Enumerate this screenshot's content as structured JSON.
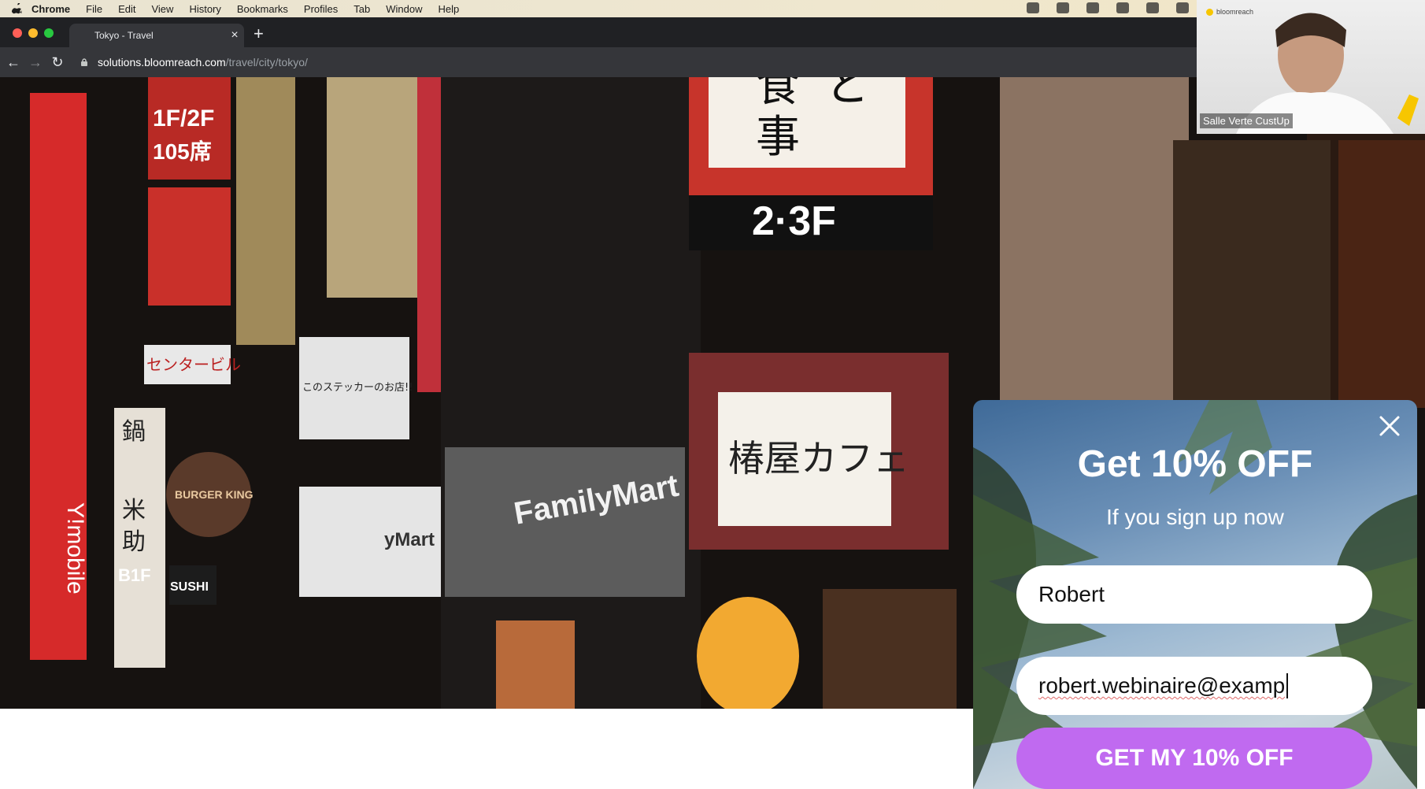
{
  "menubar": {
    "items": [
      "Chrome",
      "File",
      "Edit",
      "View",
      "History",
      "Bookmarks",
      "Profiles",
      "Tab",
      "Window",
      "Help"
    ]
  },
  "browser": {
    "tab_title": "Tokyo - Travel",
    "url_host": "solutions.bloomreach.com",
    "url_path": "/travel/city/tokyo/"
  },
  "hero": {
    "signs": [
      "1F/2F",
      "105席",
      "2·3F",
      "食",
      "事",
      "と",
      "センタービル",
      "このステッカーのお店!!",
      "鍋",
      "米",
      "助",
      "B1F",
      "FamilyMart",
      "yMart",
      "Y!mobile",
      "BURGER KING",
      "SUSHI",
      "椿屋カフェ"
    ]
  },
  "video": {
    "logo_text": "bloomreach",
    "caption": "Salle Verte CustUp"
  },
  "popup": {
    "title": "Get 10% OFF",
    "subtitle": "If you sign up now",
    "name_value": "Robert",
    "email_value": "robert.webinaire@examp",
    "cta_label": "GET MY 10% OFF"
  },
  "colors": {
    "cta": "#c06af0",
    "chrome_dark": "#202124",
    "chrome_toolbar": "#35363a"
  }
}
